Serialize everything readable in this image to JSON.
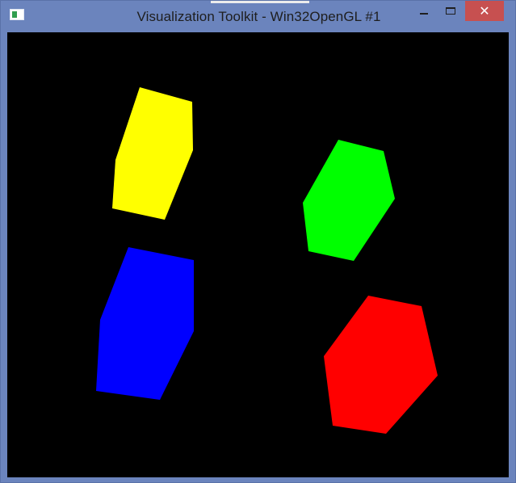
{
  "window": {
    "title": "Visualization Toolkit - Win32OpenGL #1",
    "icon": "vtk-window-icon",
    "controls": {
      "minimize_icon": "minimize-icon",
      "maximize_icon": "maximize-icon",
      "close_icon": "close-icon",
      "close_glyph": "✕"
    },
    "colors": {
      "frame": "#6b84bd",
      "close_button": "#c75050",
      "render_background": "#000000"
    }
  },
  "scene": {
    "shapes": [
      {
        "name": "yellow-hexagon",
        "color": "#ffff00"
      },
      {
        "name": "green-hexagon",
        "color": "#00ff00"
      },
      {
        "name": "blue-hexagon",
        "color": "#0000ff"
      },
      {
        "name": "red-hexagon",
        "color": "#ff0000"
      }
    ]
  }
}
